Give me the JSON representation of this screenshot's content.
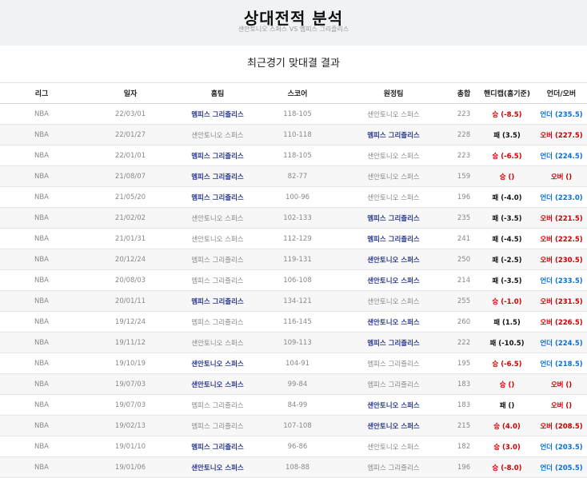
{
  "header": {
    "title": "상대전적 분석",
    "subtitle": "샌안토니오 스퍼스 VS 멤피스 그리즐리스"
  },
  "section_title": "최근경기 맞대결 결과",
  "columns": [
    "리그",
    "일자",
    "홈팀",
    "스코어",
    "원정팀",
    "총합",
    "핸디캡(홈기준)",
    "언더/오버"
  ],
  "colors": {
    "team_win": "#2b3a8c",
    "handicap_win": "#d20000",
    "under": "#0b6fd6",
    "over": "#c80000"
  },
  "rows": [
    {
      "league": "NBA",
      "date": "22/03/01",
      "home": "멤피스 그리즐리스",
      "score": "118-105",
      "away": "샌안토니오 스퍼스",
      "total": "223",
      "handicap": "승 (-8.5)",
      "ou": "언더 (235.5)",
      "winner": "home",
      "hc_result": "win",
      "ou_result": "under"
    },
    {
      "league": "NBA",
      "date": "22/01/27",
      "home": "샌안토니오 스퍼스",
      "score": "110-118",
      "away": "멤피스 그리즐리스",
      "total": "228",
      "handicap": "패 (3.5)",
      "ou": "오버 (227.5)",
      "winner": "away",
      "hc_result": "lose",
      "ou_result": "over"
    },
    {
      "league": "NBA",
      "date": "22/01/01",
      "home": "멤피스 그리즐리스",
      "score": "118-105",
      "away": "샌안토니오 스퍼스",
      "total": "223",
      "handicap": "승 (-6.5)",
      "ou": "언더 (224.5)",
      "winner": "home",
      "hc_result": "win",
      "ou_result": "under"
    },
    {
      "league": "NBA",
      "date": "21/08/07",
      "home": "멤피스 그리즐리스",
      "score": "82-77",
      "away": "샌안토니오 스퍼스",
      "total": "159",
      "handicap": "승 ()",
      "ou": "오버 ()",
      "winner": "home",
      "hc_result": "win",
      "ou_result": "over"
    },
    {
      "league": "NBA",
      "date": "21/05/20",
      "home": "멤피스 그리즐리스",
      "score": "100-96",
      "away": "샌안토니오 스퍼스",
      "total": "196",
      "handicap": "패 (-4.0)",
      "ou": "언더 (223.0)",
      "winner": "home",
      "hc_result": "lose",
      "ou_result": "under"
    },
    {
      "league": "NBA",
      "date": "21/02/02",
      "home": "샌안토니오 스퍼스",
      "score": "102-133",
      "away": "멤피스 그리즐리스",
      "total": "235",
      "handicap": "패 (-3.5)",
      "ou": "오버 (221.5)",
      "winner": "away",
      "hc_result": "lose",
      "ou_result": "over"
    },
    {
      "league": "NBA",
      "date": "21/01/31",
      "home": "샌안토니오 스퍼스",
      "score": "112-129",
      "away": "멤피스 그리즐리스",
      "total": "241",
      "handicap": "패 (-4.5)",
      "ou": "오버 (222.5)",
      "winner": "away",
      "hc_result": "lose",
      "ou_result": "over"
    },
    {
      "league": "NBA",
      "date": "20/12/24",
      "home": "멤피스 그리즐리스",
      "score": "119-131",
      "away": "샌안토니오 스퍼스",
      "total": "250",
      "handicap": "패 (-2.5)",
      "ou": "오버 (230.5)",
      "winner": "away",
      "hc_result": "lose",
      "ou_result": "over"
    },
    {
      "league": "NBA",
      "date": "20/08/03",
      "home": "멤피스 그리즐리스",
      "score": "106-108",
      "away": "샌안토니오 스퍼스",
      "total": "214",
      "handicap": "패 (-3.5)",
      "ou": "언더 (233.5)",
      "winner": "away",
      "hc_result": "lose",
      "ou_result": "under"
    },
    {
      "league": "NBA",
      "date": "20/01/11",
      "home": "멤피스 그리즐리스",
      "score": "134-121",
      "away": "샌안토니오 스퍼스",
      "total": "255",
      "handicap": "승 (-1.0)",
      "ou": "오버 (231.5)",
      "winner": "home",
      "hc_result": "win",
      "ou_result": "over"
    },
    {
      "league": "NBA",
      "date": "19/12/24",
      "home": "멤피스 그리즐리스",
      "score": "116-145",
      "away": "샌안토니오 스퍼스",
      "total": "260",
      "handicap": "패 (1.5)",
      "ou": "오버 (226.5)",
      "winner": "away",
      "hc_result": "lose",
      "ou_result": "over"
    },
    {
      "league": "NBA",
      "date": "19/11/12",
      "home": "샌안토니오 스퍼스",
      "score": "109-113",
      "away": "멤피스 그리즐리스",
      "total": "222",
      "handicap": "패 (-10.5)",
      "ou": "언더 (224.5)",
      "winner": "away",
      "hc_result": "lose",
      "ou_result": "under"
    },
    {
      "league": "NBA",
      "date": "19/10/19",
      "home": "샌안토니오 스퍼스",
      "score": "104-91",
      "away": "멤피스 그리즐리스",
      "total": "195",
      "handicap": "승 (-6.5)",
      "ou": "언더 (218.5)",
      "winner": "home",
      "hc_result": "win",
      "ou_result": "under"
    },
    {
      "league": "NBA",
      "date": "19/07/03",
      "home": "샌안토니오 스퍼스",
      "score": "99-84",
      "away": "멤피스 그리즐리스",
      "total": "183",
      "handicap": "승 ()",
      "ou": "오버 ()",
      "winner": "home",
      "hc_result": "win",
      "ou_result": "over"
    },
    {
      "league": "NBA",
      "date": "19/07/03",
      "home": "멤피스 그리즐리스",
      "score": "84-99",
      "away": "샌안토니오 스퍼스",
      "total": "183",
      "handicap": "패 ()",
      "ou": "오버 ()",
      "winner": "away",
      "hc_result": "lose",
      "ou_result": "over"
    },
    {
      "league": "NBA",
      "date": "19/02/13",
      "home": "멤피스 그리즐리스",
      "score": "107-108",
      "away": "샌안토니오 스퍼스",
      "total": "215",
      "handicap": "승 (4.0)",
      "ou": "오버 (208.5)",
      "winner": "away",
      "hc_result": "win",
      "ou_result": "over"
    },
    {
      "league": "NBA",
      "date": "19/01/10",
      "home": "멤피스 그리즐리스",
      "score": "96-86",
      "away": "샌안토니오 스퍼스",
      "total": "182",
      "handicap": "승 (3.0)",
      "ou": "언더 (203.5)",
      "winner": "home",
      "hc_result": "win",
      "ou_result": "under"
    },
    {
      "league": "NBA",
      "date": "19/01/06",
      "home": "샌안토니오 스퍼스",
      "score": "108-88",
      "away": "멤피스 그리즐리스",
      "total": "196",
      "handicap": "승 (-8.0)",
      "ou": "언더 (205.5)",
      "winner": "home",
      "hc_result": "win",
      "ou_result": "under"
    }
  ]
}
